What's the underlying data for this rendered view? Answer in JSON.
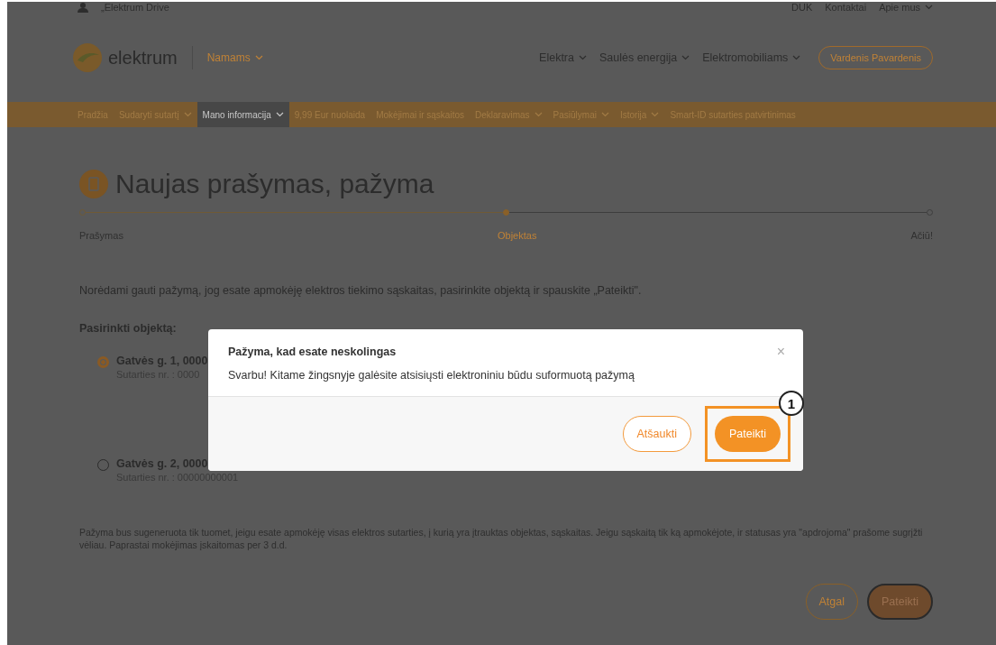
{
  "top_bar": {
    "drive_link": "„Elektrum Drive",
    "links": [
      "DUK",
      "Kontaktai",
      "Apie mus"
    ]
  },
  "header": {
    "logo": "elektrum",
    "segment": "Namams",
    "nav": [
      "Elektra",
      "Saulės energija",
      "Elektromobiliams"
    ],
    "user": "Vardenis Pavardenis"
  },
  "menu": [
    {
      "label": "Pradžia",
      "selected": false,
      "dropdown": false
    },
    {
      "label": "Sudaryti sutartį",
      "selected": false,
      "dropdown": true
    },
    {
      "label": "Mano informacija",
      "selected": true,
      "dropdown": true
    },
    {
      "label": "9,99 Eur nuolaida",
      "selected": false,
      "dropdown": false
    },
    {
      "label": "Mokėjimai ir sąskaitos",
      "selected": false,
      "dropdown": false
    },
    {
      "label": "Deklaravimas",
      "selected": false,
      "dropdown": true
    },
    {
      "label": "Pasiūlymai",
      "selected": false,
      "dropdown": true
    },
    {
      "label": "Istorija",
      "selected": false,
      "dropdown": true
    },
    {
      "label": "Smart-ID sutarties patvirtinimas",
      "selected": false,
      "dropdown": false
    }
  ],
  "page": {
    "title": "Naujas prašymas, pažyma",
    "steps": [
      {
        "label": "Prašymas",
        "completed": true,
        "current": false
      },
      {
        "label": "Objektas",
        "completed": false,
        "current": true
      },
      {
        "label": "Ačiū!",
        "completed": false,
        "current": false
      }
    ],
    "intro": "Norėdami gauti pažymą, jog esate apmokėję elektros tiekimo sąskaitas, pasirinkite objektą ir spauskite  „Pateikti\".",
    "select_label": "Pasirinkti objektą:",
    "objects": [
      {
        "address": "Gatvės g. 1, 0000",
        "contract": "Sutarties nr. : 0000",
        "selected": true
      },
      {
        "address": "Gatvės g. 2, 0000",
        "contract": "Sutarties nr. : 00000000001",
        "selected": false
      }
    ],
    "note": "Pažyma bus sugeneruota tik tuomet, jeigu esate apmokėję visas elektros sutarties, į kurią yra įtrauktas objektas, sąskaitas. Jeigu sąskaitą tik ką apmokėjote, ir statusas yra \"apdrojoma\" prašome sugrįžti vėliau. Paprastai mokėjimas įskaitomas per 3 d.d.",
    "buttons": [
      {
        "label": "Atgal",
        "kind": "secondary"
      },
      {
        "label": "Pateikti",
        "kind": "primary"
      }
    ]
  },
  "dialog": {
    "title": "Pažyma, kad esate neskolingas",
    "close": "×",
    "message": "Svarbu! Kitame žingsnyje galėsite atsisiųsti elektroniniu būdu suformuotą pažymą",
    "buttons": [
      {
        "label": "Atšaukti",
        "kind": "secondary",
        "highlighted": false
      },
      {
        "label": "Pateikti",
        "kind": "primary",
        "highlighted": true,
        "callout": "1"
      }
    ]
  }
}
